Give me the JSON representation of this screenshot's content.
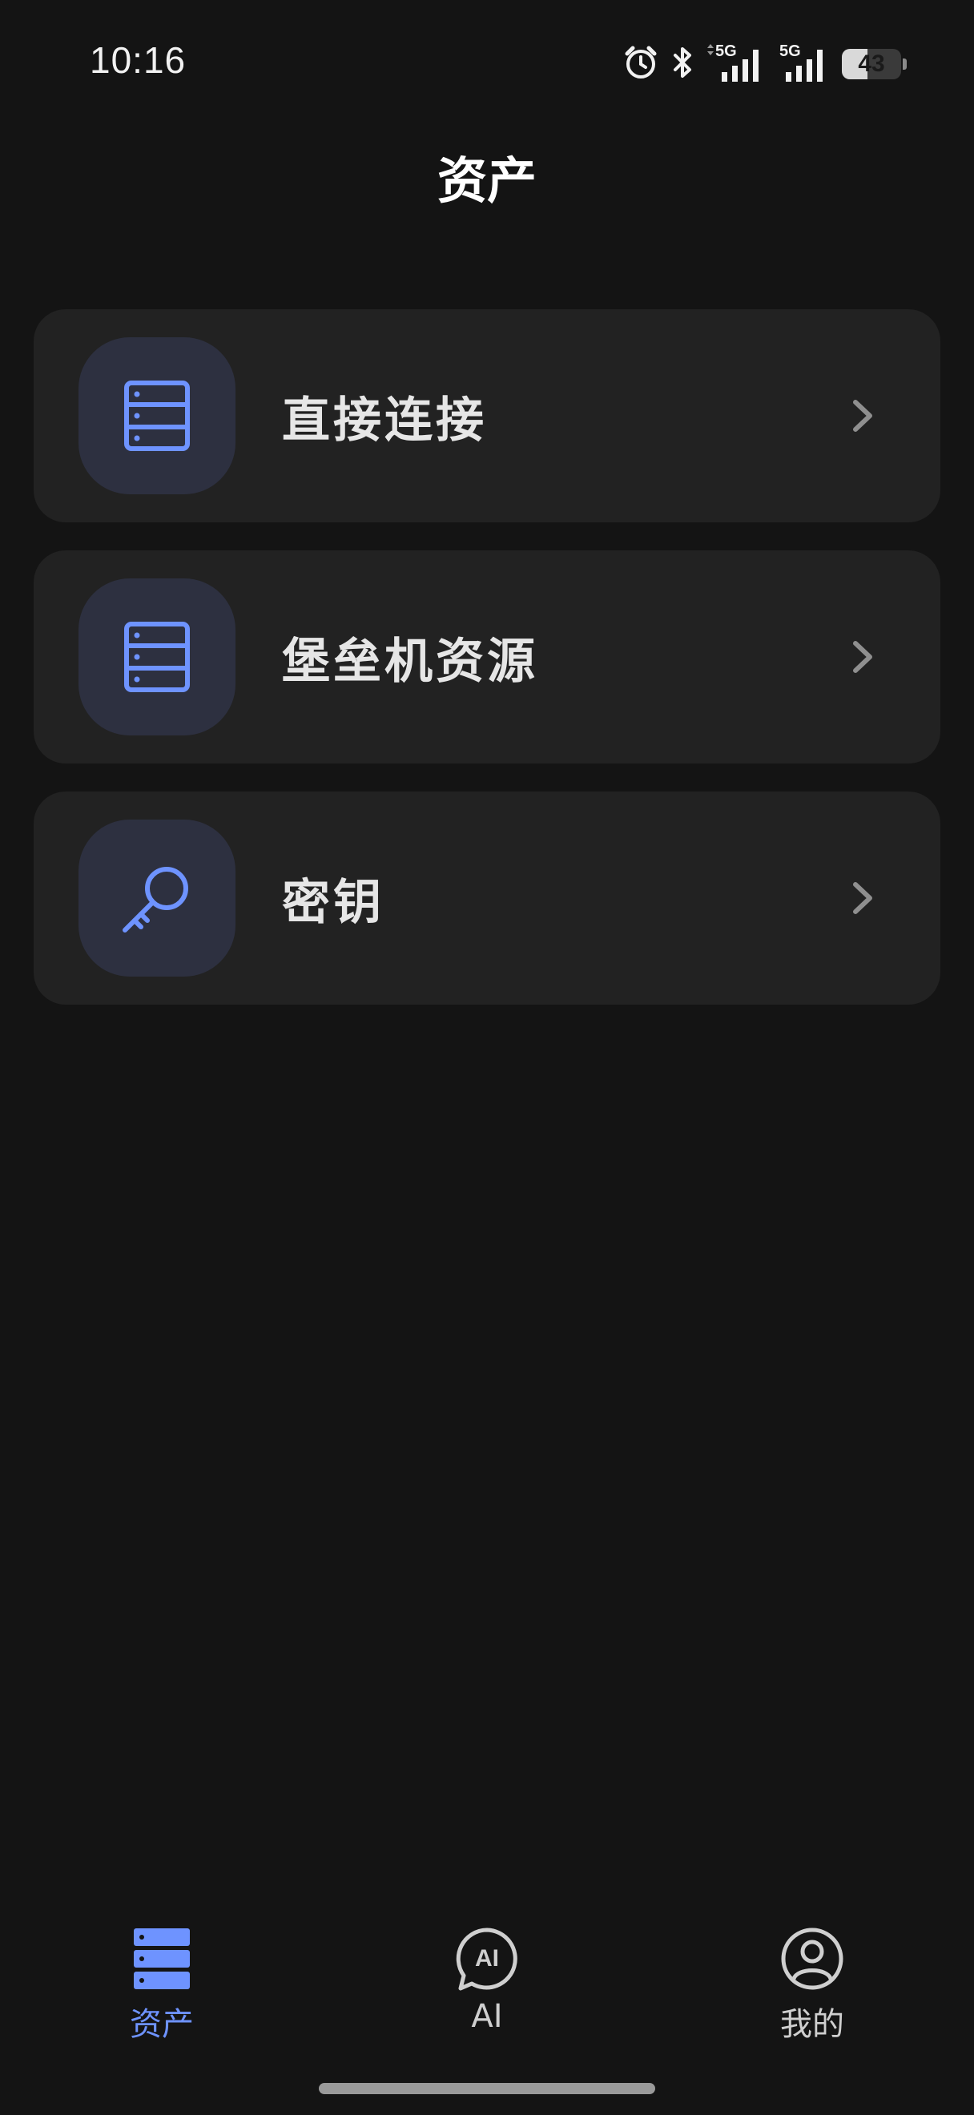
{
  "status_bar": {
    "time": "10:16",
    "battery": "43",
    "battery_percent": 43,
    "icons": [
      "alarm-icon",
      "bluetooth-icon",
      "signal-5g-icon",
      "signal-5g-icon"
    ]
  },
  "header": {
    "title": "资产"
  },
  "menu": {
    "items": [
      {
        "label": "直接连接",
        "icon": "server-icon"
      },
      {
        "label": "堡垒机资源",
        "icon": "server-icon"
      },
      {
        "label": "密钥",
        "icon": "key-icon"
      }
    ]
  },
  "bottom_nav": {
    "items": [
      {
        "label": "资产",
        "icon": "server-stack-icon",
        "active": true
      },
      {
        "label": "AI",
        "icon": "ai-chat-icon",
        "active": false
      },
      {
        "label": "我的",
        "icon": "user-icon",
        "active": false
      }
    ]
  },
  "colors": {
    "background": "#141414",
    "card": "#222222",
    "icon_bg": "#2d3040",
    "accent": "#6e93ff",
    "text": "#e6e6e6"
  }
}
